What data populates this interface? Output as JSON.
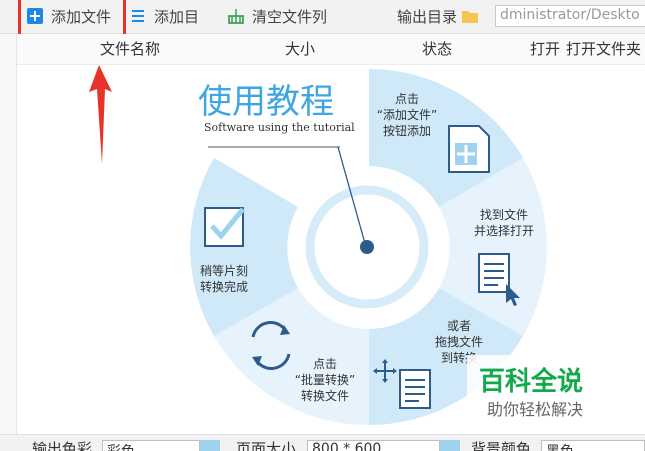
{
  "toolbar": {
    "add_file": "添加文件",
    "add_dir": "添加目",
    "clear_list": "清空文件列",
    "output_dir_label": "输出目录",
    "output_path": "dministrator/Deskto"
  },
  "columns": {
    "name": "文件名称",
    "size": "大小",
    "status": "状态",
    "open": "打开",
    "open_folder": "打开文件夹"
  },
  "tutorial": {
    "title": "使用教程",
    "subtitle": "Software using the tutorial",
    "step1": [
      "点击",
      "“添加文件”",
      "按钮添加"
    ],
    "step2": [
      "找到文件",
      "并选择打开"
    ],
    "step3": [
      "或者",
      "拖拽文件",
      "到转换"
    ],
    "step4": [
      "点击",
      "“批量转换”",
      "转换文件"
    ],
    "step5": [
      "稍等片刻",
      "转换完成"
    ]
  },
  "bottombar": {
    "color_label": "输出色彩",
    "color_value": "彩色",
    "page_size_label": "页面大小",
    "page_size_value": "800 * 600",
    "bg_color_label": "背景颜色",
    "bg_color_value": "黑色"
  },
  "watermark": {
    "title": "百科全说",
    "subtitle": "助你轻松解决"
  },
  "colors": {
    "accent": "#1e88e5",
    "ring_light": "#e6f3fc",
    "ring_mid": "#cfe9f8",
    "ring_dark": "#b9e0f6",
    "highlight": "#e8332b",
    "watermark": "#13a94a"
  }
}
